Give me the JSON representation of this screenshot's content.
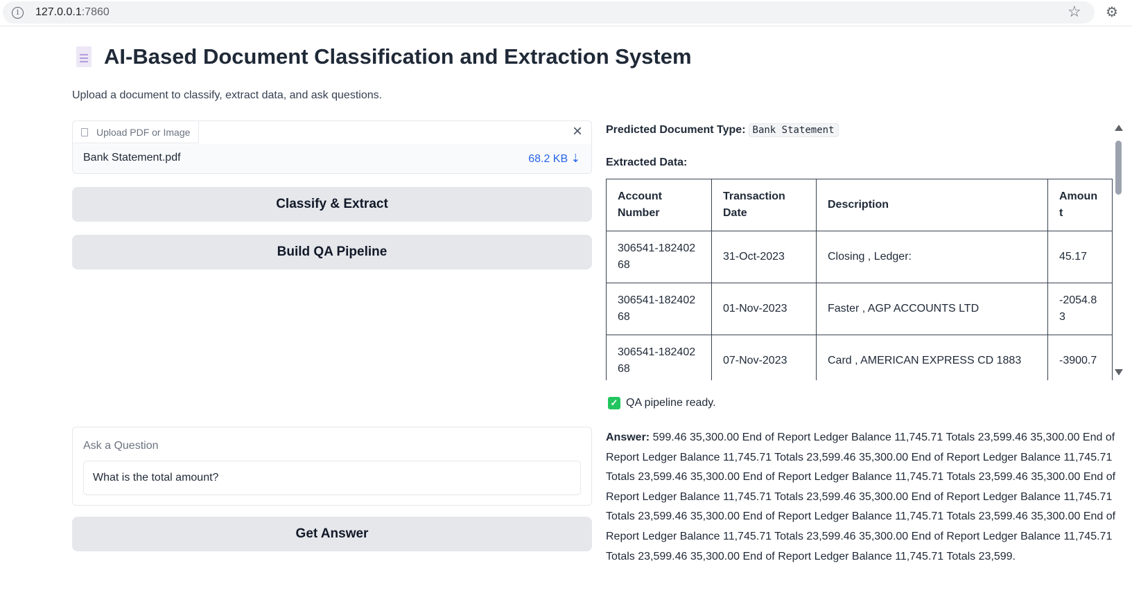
{
  "browser": {
    "url_host": "127.0.0.1",
    "url_port": ":7860"
  },
  "header": {
    "title": "AI-Based Document Classification and Extraction System",
    "subtitle": "Upload a document to classify, extract data, and ask questions."
  },
  "upload": {
    "label": "Upload PDF or Image",
    "file_name": "Bank Statement.pdf",
    "file_size": "68.2 KB ⇣"
  },
  "buttons": {
    "classify": "Classify & Extract",
    "build_qa": "Build QA Pipeline",
    "get_answer": "Get Answer"
  },
  "question": {
    "label": "Ask a Question",
    "value": "What is the total amount?"
  },
  "prediction": {
    "label": "Predicted Document Type:",
    "value": "Bank Statement"
  },
  "extracted": {
    "label": "Extracted Data:",
    "columns": [
      "Account Number",
      "Transaction Date",
      "Description",
      "Amount"
    ],
    "rows": [
      [
        "306541-18240268",
        "31-Oct-2023",
        "Closing , Ledger:",
        "45.17"
      ],
      [
        "306541-18240268",
        "01-Nov-2023",
        "Faster , AGP ACCOUNTS LTD",
        "-2054.83"
      ],
      [
        "306541-18240268",
        "07-Nov-2023",
        "Card , AMERICAN EXPRESS CD 1883",
        "-3900.7"
      ]
    ]
  },
  "status": {
    "text": "QA pipeline ready."
  },
  "answer": {
    "label": "Answer:",
    "text": "599.46 35,300.00 End of Report Ledger Balance 11,745.71 Totals 23,599.46 35,300.00 End of Report Ledger Balance 11,745.71 Totals 23,599.46 35,300.00 End of Report Ledger Balance 11,745.71 Totals 23,599.46 35,300.00 End of Report Ledger Balance 11,745.71 Totals 23,599.46 35,300.00 End of Report Ledger Balance 11,745.71 Totals 23,599.46 35,300.00 End of Report Ledger Balance 11,745.71 Totals 23,599.46 35,300.00 End of Report Ledger Balance 11,745.71 Totals 23,599.46 35,300.00 End of Report Ledger Balance 11,745.71 Totals 23,599.46 35,300.00 End of Report Ledger Balance 11,745.71 Totals 23,599.46 35,300.00 End of Report Ledger Balance 11,745.71 Totals 23,599."
  }
}
